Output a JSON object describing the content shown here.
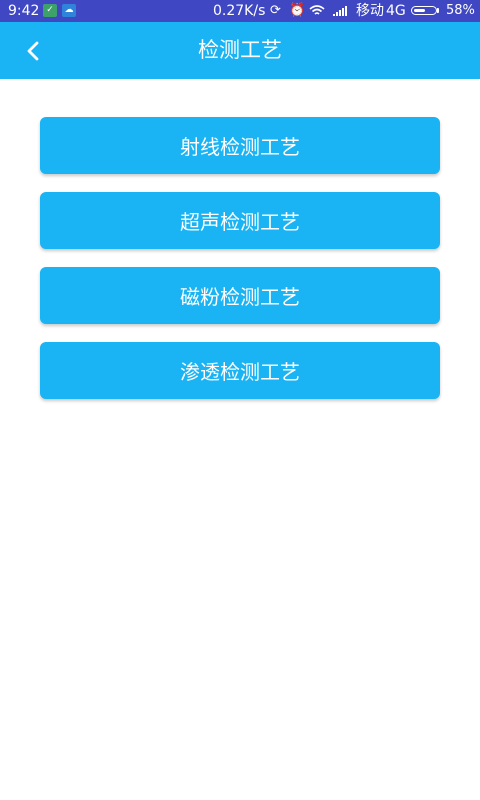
{
  "status_bar": {
    "time": "9:42",
    "net_speed": "0.27K/s",
    "carrier": "移动",
    "network_type": "4G",
    "battery_percent": "58%",
    "battery_level": 0.58,
    "icons": [
      "shield-icon",
      "cloud-icon",
      "sync-icon",
      "alarm-icon",
      "wifi-icon",
      "signal-icon",
      "battery-icon"
    ]
  },
  "toolbar": {
    "title": "检测工艺",
    "back_icon": "chevron-left-icon"
  },
  "menu": {
    "items": [
      {
        "label": "射线检测工艺"
      },
      {
        "label": "超声检测工艺"
      },
      {
        "label": "磁粉检测工艺"
      },
      {
        "label": "渗透检测工艺"
      }
    ]
  },
  "colors": {
    "status_bar_bg": "#3f48c2",
    "primary": "#1ab3f3",
    "background": "#ffffff",
    "text_on_primary": "#ffffff"
  }
}
